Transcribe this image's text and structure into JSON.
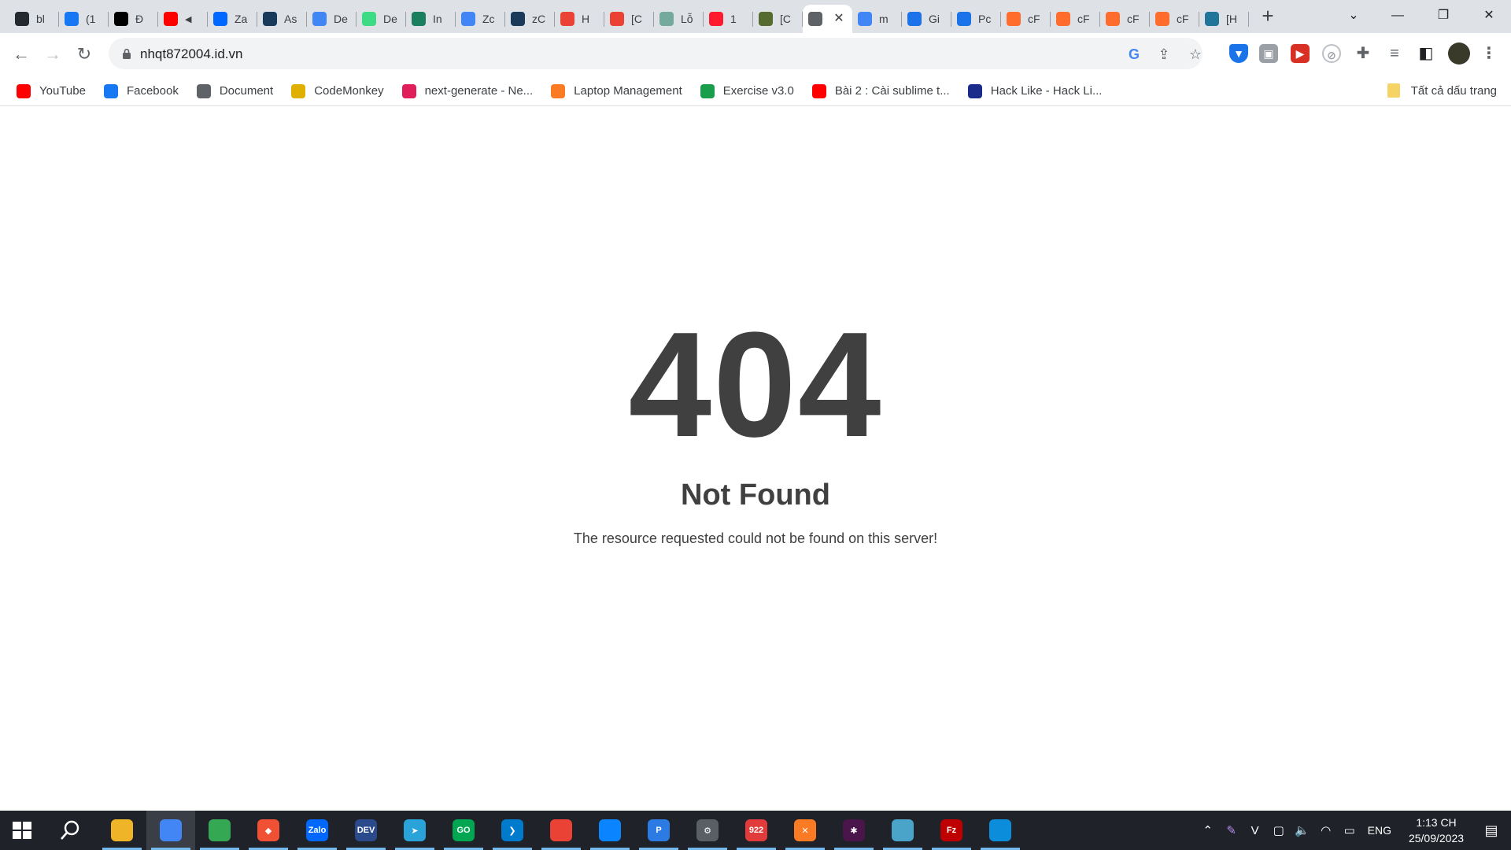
{
  "browser": {
    "tabs": [
      {
        "title": "bl",
        "icon": "github-icon",
        "color": "#24292f"
      },
      {
        "title": "(1",
        "icon": "facebook-icon",
        "color": "#1877f2"
      },
      {
        "title": "Đ",
        "icon": "tiktok-icon",
        "color": "#000000"
      },
      {
        "title": "",
        "icon": "youtube-icon",
        "color": "#ff0000",
        "muted": true
      },
      {
        "title": "Za",
        "icon": "zalo-icon",
        "color": "#0068ff"
      },
      {
        "title": "As",
        "icon": "dollar-icon",
        "color": "#1a3a5c"
      },
      {
        "title": "De",
        "icon": "google-icon",
        "color": "#4285f4"
      },
      {
        "title": "De",
        "icon": "android-icon",
        "color": "#3ddc84"
      },
      {
        "title": "In",
        "icon": "chat-icon",
        "color": "#1b7f5e"
      },
      {
        "title": "Zc",
        "icon": "google-icon",
        "color": "#4285f4"
      },
      {
        "title": "zC",
        "icon": "dollar-icon",
        "color": "#1a3a5c"
      },
      {
        "title": "H",
        "icon": "gmail-icon",
        "color": "#ea4335"
      },
      {
        "title": "[C",
        "icon": "gmail-icon",
        "color": "#ea4335"
      },
      {
        "title": "Lỗ",
        "icon": "chatgpt-icon",
        "color": "#74aa9c"
      },
      {
        "title": "1",
        "icon": "opera-icon",
        "color": "#ff1b2d"
      },
      {
        "title": "[C",
        "icon": "photo-icon",
        "color": "#556b2f"
      },
      {
        "title": "",
        "icon": "globe-icon",
        "color": "#5f6368",
        "active": true
      },
      {
        "title": "m",
        "icon": "google-icon",
        "color": "#4285f4"
      },
      {
        "title": "Gi",
        "icon": "cloud-icon",
        "color": "#1a73e8"
      },
      {
        "title": "Pc",
        "icon": "cloud-icon",
        "color": "#1a73e8"
      },
      {
        "title": "cF",
        "icon": "cpanel-icon",
        "color": "#ff6c2c"
      },
      {
        "title": "cF",
        "icon": "cpanel-icon",
        "color": "#ff6c2c"
      },
      {
        "title": "cF",
        "icon": "cpanel-icon",
        "color": "#ff6c2c"
      },
      {
        "title": "cF",
        "icon": "cpanel-icon",
        "color": "#ff6c2c"
      },
      {
        "title": "[H",
        "icon": "wordpress-icon",
        "color": "#21759b"
      }
    ],
    "url": "nhqt872004.id.vn",
    "bookmarks": [
      {
        "label": "YouTube",
        "icon": "youtube-icon",
        "color": "#ff0000"
      },
      {
        "label": "Facebook",
        "icon": "facebook-icon",
        "color": "#1877f2"
      },
      {
        "label": "Document",
        "icon": "globe-icon",
        "color": "#5f6368"
      },
      {
        "label": "CodeMonkey",
        "icon": "banana-icon",
        "color": "#e0b000"
      },
      {
        "label": "next-generate - Ne...",
        "icon": "slack-icon",
        "color": "#e01e5a"
      },
      {
        "label": "Laptop Management",
        "icon": "xampp-icon",
        "color": "#fb7a24"
      },
      {
        "label": "Exercise v3.0",
        "icon": "w-icon",
        "color": "#1b9e4b"
      },
      {
        "label": "Bài 2 : Cài sublime t...",
        "icon": "youtube-icon",
        "color": "#ff0000"
      },
      {
        "label": "Hack Like - Hack Li...",
        "icon": "s-icon",
        "color": "#1a2b8c"
      }
    ],
    "bookmarks_all": "Tất cả dấu trang"
  },
  "page": {
    "code": "404",
    "title": "Not Found",
    "message": "The resource requested could not be found on this server!"
  },
  "taskbar": {
    "apps": [
      {
        "name": "file-explorer-icon",
        "color": "#f0b429",
        "glyph": ""
      },
      {
        "name": "chrome-icon",
        "color": "#4285f4",
        "glyph": "",
        "active": true
      },
      {
        "name": "chrome-profile-icon",
        "color": "#34a853",
        "glyph": ""
      },
      {
        "name": "git-icon",
        "color": "#f05033",
        "glyph": "◆"
      },
      {
        "name": "zalo-icon",
        "color": "#0068ff",
        "glyph": "Zalo"
      },
      {
        "name": "devcpp-icon",
        "color": "#2b4a8b",
        "glyph": "DEV"
      },
      {
        "name": "telegram-icon",
        "color": "#2aa3d8",
        "glyph": "➤"
      },
      {
        "name": "go-icon",
        "color": "#00a651",
        "glyph": "GO"
      },
      {
        "name": "vscode-icon",
        "color": "#007acc",
        "glyph": "❯"
      },
      {
        "name": "chrome-alt-icon",
        "color": "#ea4335",
        "glyph": ""
      },
      {
        "name": "firefox-icon",
        "color": "#0a84ff",
        "glyph": ""
      },
      {
        "name": "proxy-icon",
        "color": "#2c7be5",
        "glyph": "P"
      },
      {
        "name": "settings-icon",
        "color": "#5a5f66",
        "glyph": "⚙"
      },
      {
        "name": "922-icon",
        "color": "#e23b3b",
        "glyph": "922"
      },
      {
        "name": "xampp-icon",
        "color": "#fb7a24",
        "glyph": "✕"
      },
      {
        "name": "slack-icon",
        "color": "#4a154b",
        "glyph": "✱"
      },
      {
        "name": "notes-icon",
        "color": "#4aa3c9",
        "glyph": ""
      },
      {
        "name": "filezilla-icon",
        "color": "#bf0000",
        "glyph": "Fz"
      },
      {
        "name": "edge-icon",
        "color": "#0c8ddb",
        "glyph": ""
      }
    ],
    "lang": "ENG",
    "time": "1:13 CH",
    "date": "25/09/2023"
  }
}
